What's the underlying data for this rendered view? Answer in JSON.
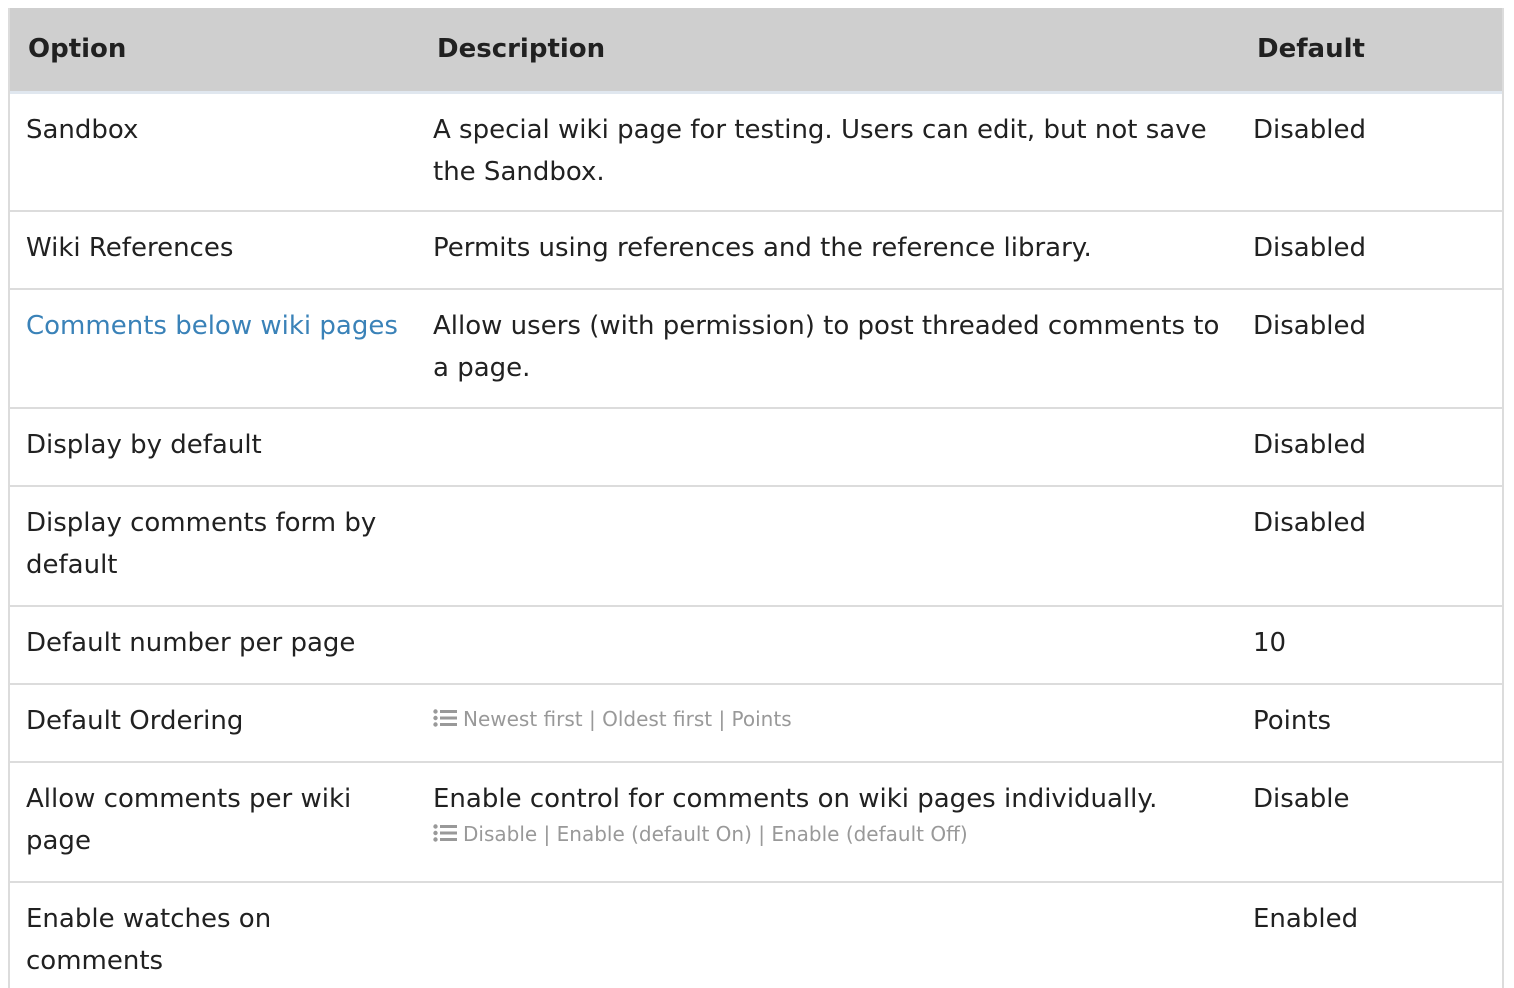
{
  "header": {
    "option": "Option",
    "description": "Description",
    "default": "Default"
  },
  "rows": [
    {
      "option": "Sandbox",
      "description": "A special wiki page for testing. Users can edit, but not save the Sandbox.",
      "default": "Disabled"
    },
    {
      "option": "Wiki References",
      "description": "Permits using references and the reference library.",
      "default": "Disabled"
    },
    {
      "option": "Comments below wiki pages",
      "description": "Allow users (with permission) to post threaded comments to a page.",
      "default": "Disabled"
    },
    {
      "option": "Display by default",
      "description": "",
      "default": "Disabled"
    },
    {
      "option": "Display comments form by default",
      "description": "",
      "default": "Disabled"
    },
    {
      "option": "Default number per page",
      "description": "",
      "default": "10"
    },
    {
      "option": "Default Ordering",
      "description": "",
      "choices": "Newest first | Oldest first | Points",
      "default": "Points"
    },
    {
      "option": "Allow comments per wiki page",
      "description": "Enable control for comments on wiki pages individually.",
      "choices": "Disable | Enable (default On) | Enable (default Off)",
      "default": "Disable"
    },
    {
      "option": "Enable watches on comments",
      "description": "",
      "default": "Enabled"
    }
  ],
  "icons": {
    "choices": "list-icon"
  },
  "colors": {
    "header_bg": "#cfcfcf",
    "link": "#3a82b8",
    "choices_text": "#999999"
  }
}
